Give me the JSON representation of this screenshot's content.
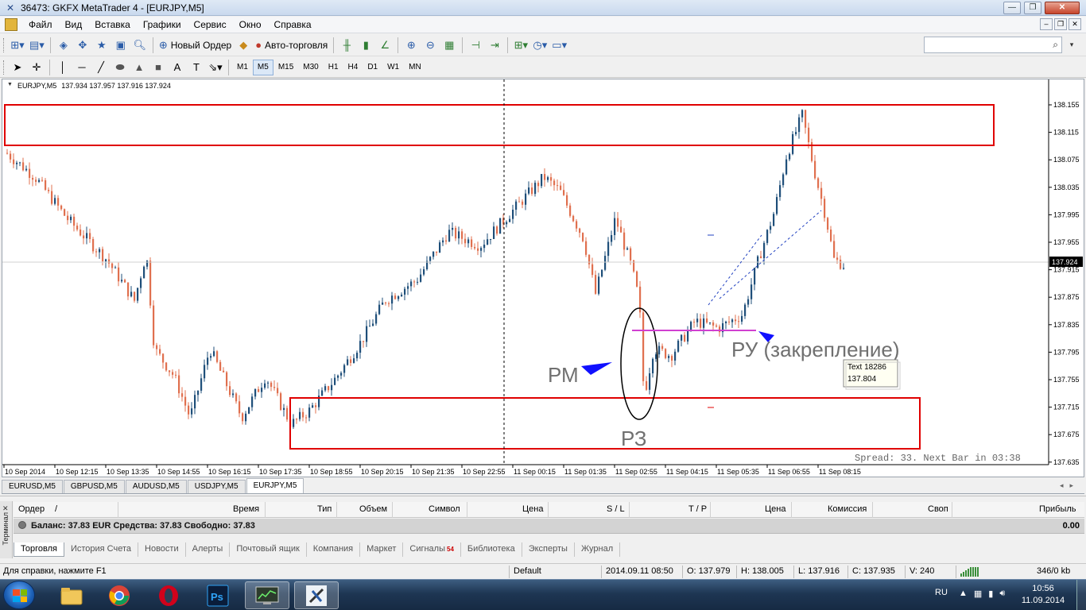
{
  "window": {
    "title": "36473: GKFX MetaTrader 4 - [EURJPY,M5]",
    "minimize": "—",
    "maximize": "❐",
    "close": "✕"
  },
  "menu": [
    "Файл",
    "Вид",
    "Вставка",
    "Графики",
    "Сервис",
    "Окно",
    "Справка"
  ],
  "toolbar": {
    "new_order": "Новый Ордер",
    "auto_trading": "Авто-торговля",
    "timeframes": [
      "M1",
      "M5",
      "M15",
      "M30",
      "H1",
      "H4",
      "D1",
      "W1",
      "MN"
    ],
    "active_timeframe": "M5"
  },
  "chart": {
    "header_symbol": "EURJPY,M5",
    "header_ohlc": "137.934 137.957 137.916 137.924",
    "spread_text": "Spread: 33. Next Bar in 03:38",
    "current_price": "137.924",
    "price_labels": [
      "138.155",
      "138.115",
      "138.075",
      "138.035",
      "137.995",
      "137.955",
      "137.915",
      "137.875",
      "137.835",
      "137.795",
      "137.755",
      "137.715",
      "137.675",
      "137.635"
    ],
    "time_labels": [
      "10 Sep 2014",
      "10 Sep 12:15",
      "10 Sep 13:35",
      "10 Sep 14:55",
      "10 Sep 16:15",
      "10 Sep 17:35",
      "10 Sep 18:55",
      "10 Sep 20:15",
      "10 Sep 21:35",
      "10 Sep 22:55",
      "11 Sep 00:15",
      "11 Sep 01:35",
      "11 Sep 02:55",
      "11 Sep 04:15",
      "11 Sep 05:35",
      "11 Sep 06:55",
      "11 Sep 08:15"
    ],
    "annotations": {
      "rm": "РМ",
      "rz": "РЗ",
      "ru": "РУ (закрепление)",
      "tooltip_line1": "Text 18286",
      "tooltip_line2": "137.804"
    },
    "colors": {
      "bull": "#1f4f7a",
      "bear": "#e0704f",
      "zone": "#e00000",
      "magenta": "#d040d0",
      "blue_arrow": "#0000ff"
    }
  },
  "chart_tabs": [
    "EURUSD,M5",
    "GBPUSD,M5",
    "AUDUSD,M5",
    "USDJPY,M5",
    "EURJPY,M5"
  ],
  "active_chart_tab": "EURJPY,M5",
  "terminal": {
    "side_label": "Терминал",
    "columns": [
      "Ордер",
      "/",
      "Время",
      "Тип",
      "Объем",
      "Символ",
      "Цена",
      "S / L",
      "T / P",
      "Цена",
      "Комиссия",
      "Своп",
      "Прибыль"
    ],
    "balance_text": "Баланс: 37.83 EUR  Средства: 37.83  Свободно: 37.83",
    "profit": "0.00",
    "tabs": [
      "Торговля",
      "История Счета",
      "Новости",
      "Алерты",
      "Почтовый ящик",
      "Компания",
      "Маркет",
      "Сигналы",
      "Библиотека",
      "Эксперты",
      "Журнал"
    ],
    "signals_badge": "54",
    "active_tab": "Торговля"
  },
  "status": {
    "help": "Для справки, нажмите F1",
    "profile": "Default",
    "datetime": "2014.09.11 08:50",
    "open": "O: 137.979",
    "high": "H: 138.005",
    "low": "L: 137.916",
    "close": "C: 137.935",
    "volume": "V: 240",
    "traffic": "346/0 kb"
  },
  "taskbar": {
    "lang": "RU",
    "time": "10:56",
    "date": "11.09.2014",
    "photoshop_label": "Ps"
  }
}
